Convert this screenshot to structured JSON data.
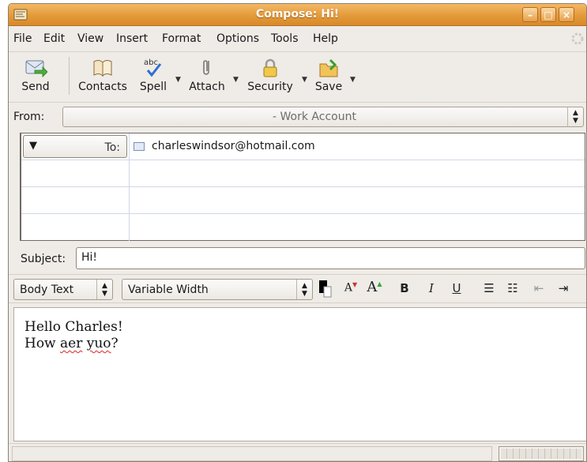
{
  "window": {
    "title": "Compose: Hi!"
  },
  "menu": [
    "File",
    "Edit",
    "View",
    "Insert",
    "Format",
    "Options",
    "Tools",
    "Help"
  ],
  "toolbar": {
    "send": "Send",
    "contacts": "Contacts",
    "spell": "Spell",
    "attach": "Attach",
    "security": "Security",
    "save": "Save"
  },
  "from": {
    "label": "From:",
    "account": "- Work Account"
  },
  "recipients": [
    {
      "type": "To:",
      "address": "charleswindsor@hotmail.com"
    }
  ],
  "subject": {
    "label": "Subject:",
    "value": "Hi!"
  },
  "format": {
    "paragraph_style": "Body Text",
    "font": "Variable Width",
    "text_color": "#000000",
    "bold": "B",
    "italic": "I",
    "underline": "U"
  },
  "body": {
    "line1": "Hello Charles!",
    "line2_prefix": "How ",
    "line2_word1": "aer",
    "line2_space": " ",
    "line2_word2": "yuo",
    "line2_suffix": "?"
  },
  "colors": {
    "title_bar": "#e39a3a",
    "accent": "#d98a2a"
  }
}
